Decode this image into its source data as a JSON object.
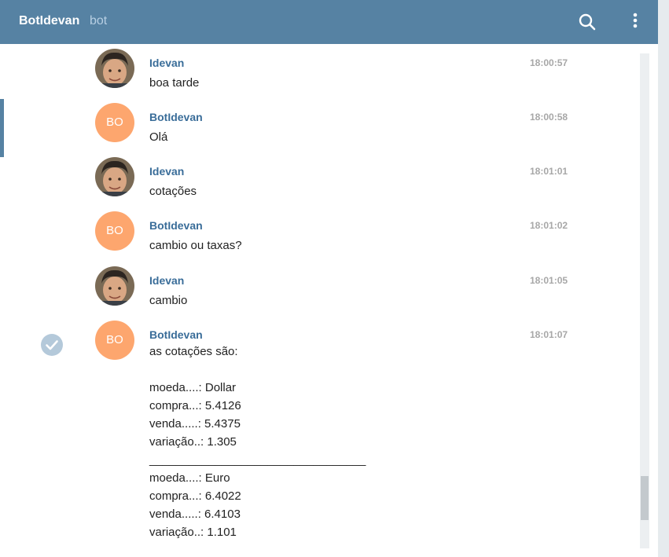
{
  "header": {
    "title": "BotIdevan",
    "subtitle": "bot",
    "search_icon": "search-icon",
    "menu_icon": "more-vertical-icon"
  },
  "avatars": {
    "bot_initials": "BO",
    "bot_color": "#fda66e"
  },
  "colors": {
    "header_bg": "#5682a3",
    "sender_name": "#3a6d99",
    "time": "#a7a7a7"
  },
  "messages": [
    {
      "sender": "Idevan",
      "time": "18:00:57",
      "text": "boa tarde"
    },
    {
      "sender": "BotIdevan",
      "time": "18:00:58",
      "text": "Olá"
    },
    {
      "sender": "Idevan",
      "time": "18:01:01",
      "text": "cotações"
    },
    {
      "sender": "BotIdevan",
      "time": "18:01:02",
      "text": "cambio ou taxas?"
    },
    {
      "sender": "Idevan",
      "time": "18:01:05",
      "text": "cambio"
    },
    {
      "sender": "BotIdevan",
      "time": "18:01:07",
      "lines": [
        "as cotações são:",
        "",
        "moeda....: Dollar",
        "compra...: 5.4126",
        "venda.....: 5.4375",
        "variação..: 1.305",
        "_________________________________",
        "moeda....: Euro",
        "compra...: 6.4022",
        "venda.....: 6.4103",
        "variação..: 1.101"
      ]
    }
  ]
}
